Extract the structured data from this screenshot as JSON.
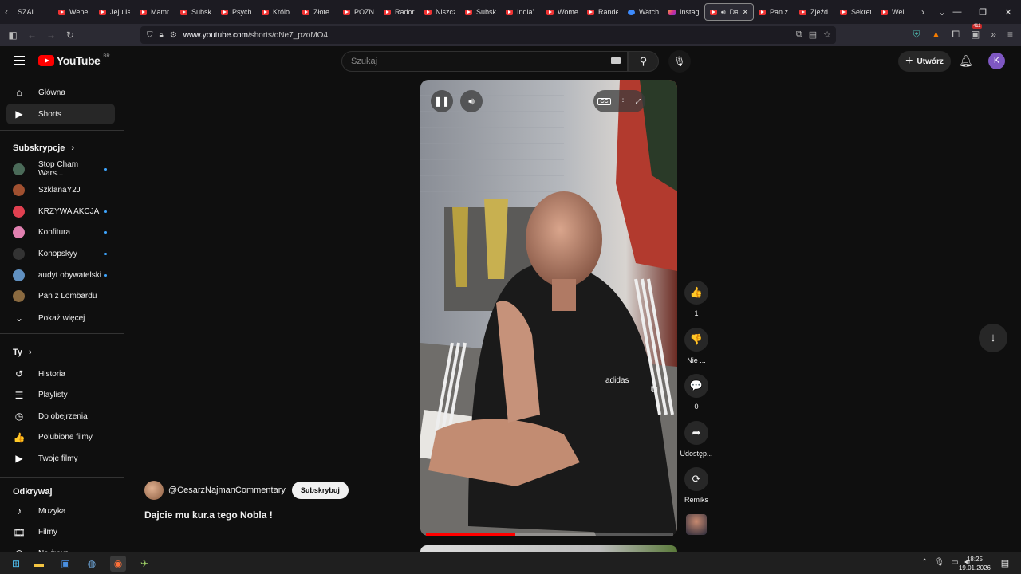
{
  "browser": {
    "tabs": [
      {
        "label": "SZAL",
        "fav": "none"
      },
      {
        "label": "Wene",
        "fav": "yt"
      },
      {
        "label": "Jeju Is",
        "fav": "yt"
      },
      {
        "label": "Mamr",
        "fav": "yt"
      },
      {
        "label": "Subsk",
        "fav": "yt"
      },
      {
        "label": "Psych",
        "fav": "yt"
      },
      {
        "label": "Królo",
        "fav": "yt"
      },
      {
        "label": "Złote",
        "fav": "yt"
      },
      {
        "label": "POZN",
        "fav": "yt"
      },
      {
        "label": "Rador",
        "fav": "yt"
      },
      {
        "label": "Niszcz",
        "fav": "yt"
      },
      {
        "label": "Subsk",
        "fav": "yt"
      },
      {
        "label": "India'",
        "fav": "yt"
      },
      {
        "label": "Wome",
        "fav": "yt"
      },
      {
        "label": "Rande",
        "fav": "yt"
      },
      {
        "label": "Watch",
        "fav": "watch"
      },
      {
        "label": "Instag",
        "fav": "ig"
      },
      {
        "label": "Daj",
        "fav": "yt",
        "active": true
      },
      {
        "label": "Pan z",
        "fav": "yt"
      },
      {
        "label": "Zjeźd",
        "fav": "yt"
      },
      {
        "label": "Sekret",
        "fav": "yt"
      },
      {
        "label": "Wei",
        "fav": "yt"
      }
    ],
    "url_host": "www.youtube.com",
    "url_path": "/shorts/oNe7_pzoMO4",
    "ext_badge": "411"
  },
  "header": {
    "logo_text": "YouTube",
    "logo_country": "BR",
    "search_placeholder": "Szukaj",
    "create_label": "Utwórz",
    "avatar_letter": "K"
  },
  "sidebar": {
    "main": [
      {
        "label": "Główna",
        "icon": "home-icon",
        "glyph": "⌂"
      },
      {
        "label": "Shorts",
        "icon": "shorts-icon",
        "glyph": "▶",
        "active": true
      }
    ],
    "subs_heading": "Subskrypcje",
    "subs": [
      {
        "label": "Stop Cham Wars...",
        "color": "#4a6a58",
        "dot": true
      },
      {
        "label": "SzklanaY2J",
        "color": "#a05030",
        "dot": false
      },
      {
        "label": "KRZYWA AKCJA",
        "color": "#e04050",
        "dot": true
      },
      {
        "label": "Konfitura",
        "color": "#e080b0",
        "dot": true
      },
      {
        "label": "Konopskyy",
        "color": "#333333",
        "dot": true
      },
      {
        "label": "audyt obywatelski",
        "color": "#6090c0",
        "dot": true
      },
      {
        "label": "Pan z Lombardu",
        "color": "#8a6a40",
        "dot": false
      }
    ],
    "show_more": "Pokaż więcej",
    "you_heading": "Ty",
    "you": [
      {
        "label": "Historia",
        "icon": "history-icon",
        "glyph": "↺"
      },
      {
        "label": "Playlisty",
        "icon": "playlists-icon",
        "glyph": "☰"
      },
      {
        "label": "Do obejrzenia",
        "icon": "watch-later-icon",
        "glyph": "◷"
      },
      {
        "label": "Polubione filmy",
        "icon": "liked-icon",
        "glyph": "👍"
      },
      {
        "label": "Twoje filmy",
        "icon": "your-videos-icon",
        "glyph": "▶"
      }
    ],
    "explore_heading": "Odkrywaj",
    "explore": [
      {
        "label": "Muzyka",
        "icon": "music-icon",
        "glyph": "♪"
      },
      {
        "label": "Filmy",
        "icon": "movies-icon",
        "glyph": "🎞"
      },
      {
        "label": "Na żywo",
        "icon": "live-icon",
        "glyph": "◉"
      }
    ]
  },
  "short": {
    "channel": "@CesarzNajmanCommentary",
    "subscribe_label": "Subskrybuj",
    "title": "Dajcie mu kur.a tego Nobla !",
    "progress": 0.36,
    "actions": [
      {
        "name": "like",
        "glyph": "👍",
        "label": "1"
      },
      {
        "name": "dislike",
        "glyph": "👎",
        "label": "Nie ..."
      },
      {
        "name": "comments",
        "glyph": "💬",
        "label": "0"
      },
      {
        "name": "share",
        "glyph": "➦",
        "label": "Udostęp..."
      },
      {
        "name": "remix",
        "glyph": "⟳",
        "label": "Remiks"
      }
    ]
  },
  "taskbar": {
    "time": "18:25",
    "date": "19.01.2026"
  }
}
